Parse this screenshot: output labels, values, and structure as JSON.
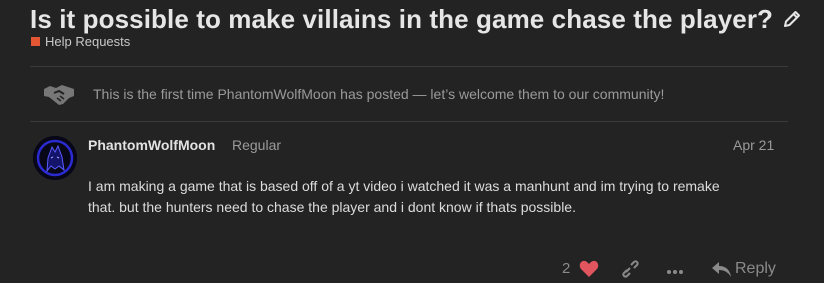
{
  "topic": {
    "title": "Is it possible to make villains in the game chase the player?",
    "category": "Help Requests"
  },
  "notice": {
    "text": "This is the first time PhantomWolfMoon has posted — let’s welcome them to our community!"
  },
  "post": {
    "username": "PhantomWolfMoon",
    "role": "Regular",
    "date": "Apr 21",
    "body_line1": "I am making a game that is based off of a yt video i watched it was a manhunt and im trying to remake",
    "body_line2": "that. but the hunters need to chase the player and i dont know if thats possible.",
    "like_count": "2",
    "reply_label": "Reply"
  },
  "colors": {
    "background": "#232323",
    "category_accent": "#e45735",
    "like_heart": "#e0555e"
  },
  "icons": [
    "pencil-icon",
    "handshake-icon",
    "heart-icon",
    "link-icon",
    "more-icon",
    "reply-icon"
  ]
}
